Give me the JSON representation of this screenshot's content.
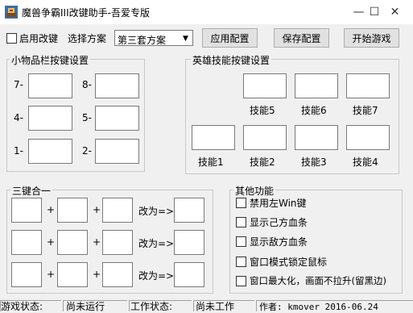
{
  "window": {
    "title": "魔兽争霸III改键助手-吾爱专版",
    "minimize_glyph": "—",
    "maximize_glyph": "☐",
    "close_glyph": "✕"
  },
  "toolbar": {
    "enable_label": "启用改键",
    "choose_scheme_label": "选择方案",
    "scheme_value": "第三套方案",
    "apply_label": "应用配置",
    "save_label": "保存配置",
    "start_label": "开始游戏"
  },
  "inventory": {
    "title": "小物品栏按键设置",
    "slots": [
      "7-",
      "8-",
      "4-",
      "5-",
      "1-",
      "2-"
    ]
  },
  "hero": {
    "title": "英雄技能按键设置",
    "skills_top": [
      "技能5",
      "技能6",
      "技能7"
    ],
    "skills_bottom": [
      "技能1",
      "技能2",
      "技能3",
      "技能4"
    ]
  },
  "combo": {
    "title": "三键合一",
    "plus": "+",
    "change_to": "改为=>"
  },
  "other": {
    "title": "其他功能",
    "options": [
      "禁用左Win键",
      "显示己方血条",
      "显示敌方血条",
      "窗口模式锁定鼠标",
      "窗口最大化，画面不拉升(留黑边)"
    ]
  },
  "status": {
    "game_state_label": "游戏状态:",
    "game_state_value": "尚未运行",
    "work_state_label": "工作状态:",
    "work_state_value": "尚未工作",
    "author": "作者: kmover  2016-06.24"
  }
}
